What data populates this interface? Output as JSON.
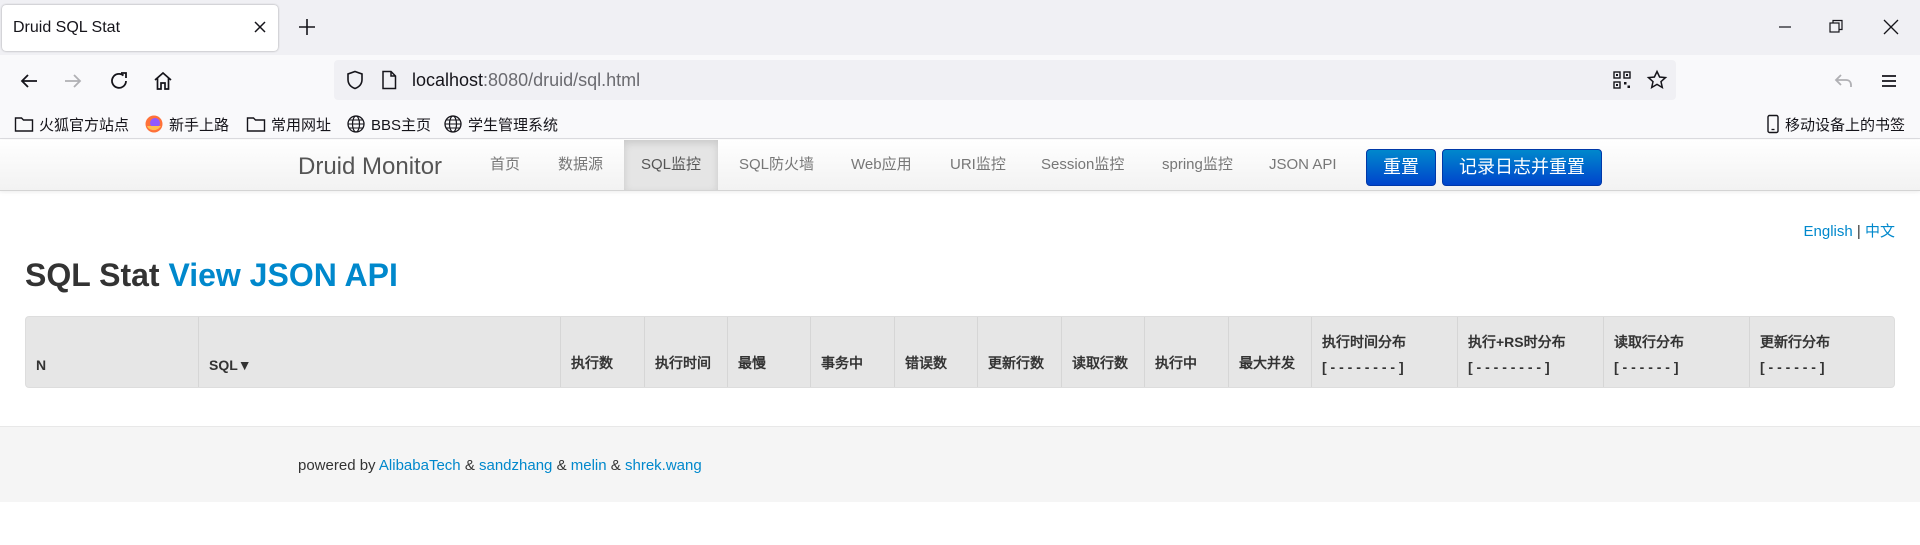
{
  "browser": {
    "tab_title": "Druid SQL Stat",
    "url_host": "localhost",
    "url_rest": ":8080/druid/sql.html",
    "bookmarks": [
      "火狐官方站点",
      "新手上路",
      "常用网址",
      "BBS主页",
      "学生管理系统"
    ],
    "mobile_bookmarks": "移动设备上的书签"
  },
  "druid": {
    "brand": "Druid Monitor",
    "nav": [
      "首页",
      "数据源",
      "SQL监控",
      "SQL防火墙",
      "Web应用",
      "URI监控",
      "Session监控",
      "spring监控",
      "JSON API"
    ],
    "active_nav": "SQL监控",
    "reset_button": "重置",
    "log_reset_button": "记录日志并重置",
    "lang_en": "English",
    "lang_sep": "|",
    "lang_zh": "中文",
    "title_main": "SQL Stat",
    "title_link": "View JSON API",
    "columns": [
      {
        "label": "N"
      },
      {
        "label": "SQL▼"
      },
      {
        "label": "执行数"
      },
      {
        "label": "执行时间"
      },
      {
        "label": "最慢"
      },
      {
        "label": "事务中"
      },
      {
        "label": "错误数"
      },
      {
        "label": "更新行数"
      },
      {
        "label": "读取行数"
      },
      {
        "label": "执行中"
      },
      {
        "label": "最大并发"
      },
      {
        "label": "执行时间分布",
        "sub": "[ - - - - - - - - ]"
      },
      {
        "label": "执行+RS时分布",
        "sub": "[ - - - - - - - - ]"
      },
      {
        "label": "读取行分布",
        "sub": "[ - - - - - - ]"
      },
      {
        "label": "更新行分布",
        "sub": "[ - - - - - - ]"
      }
    ],
    "footer": {
      "prefix": "powered by",
      "authors": [
        "AlibabaTech",
        "sandzhang",
        "melin",
        "shrek.wang"
      ],
      "sep": "&"
    }
  },
  "colors": {
    "link": "#0088cc",
    "primary_button": "#0062cc",
    "table_header_bg": "#e6e6e6"
  }
}
